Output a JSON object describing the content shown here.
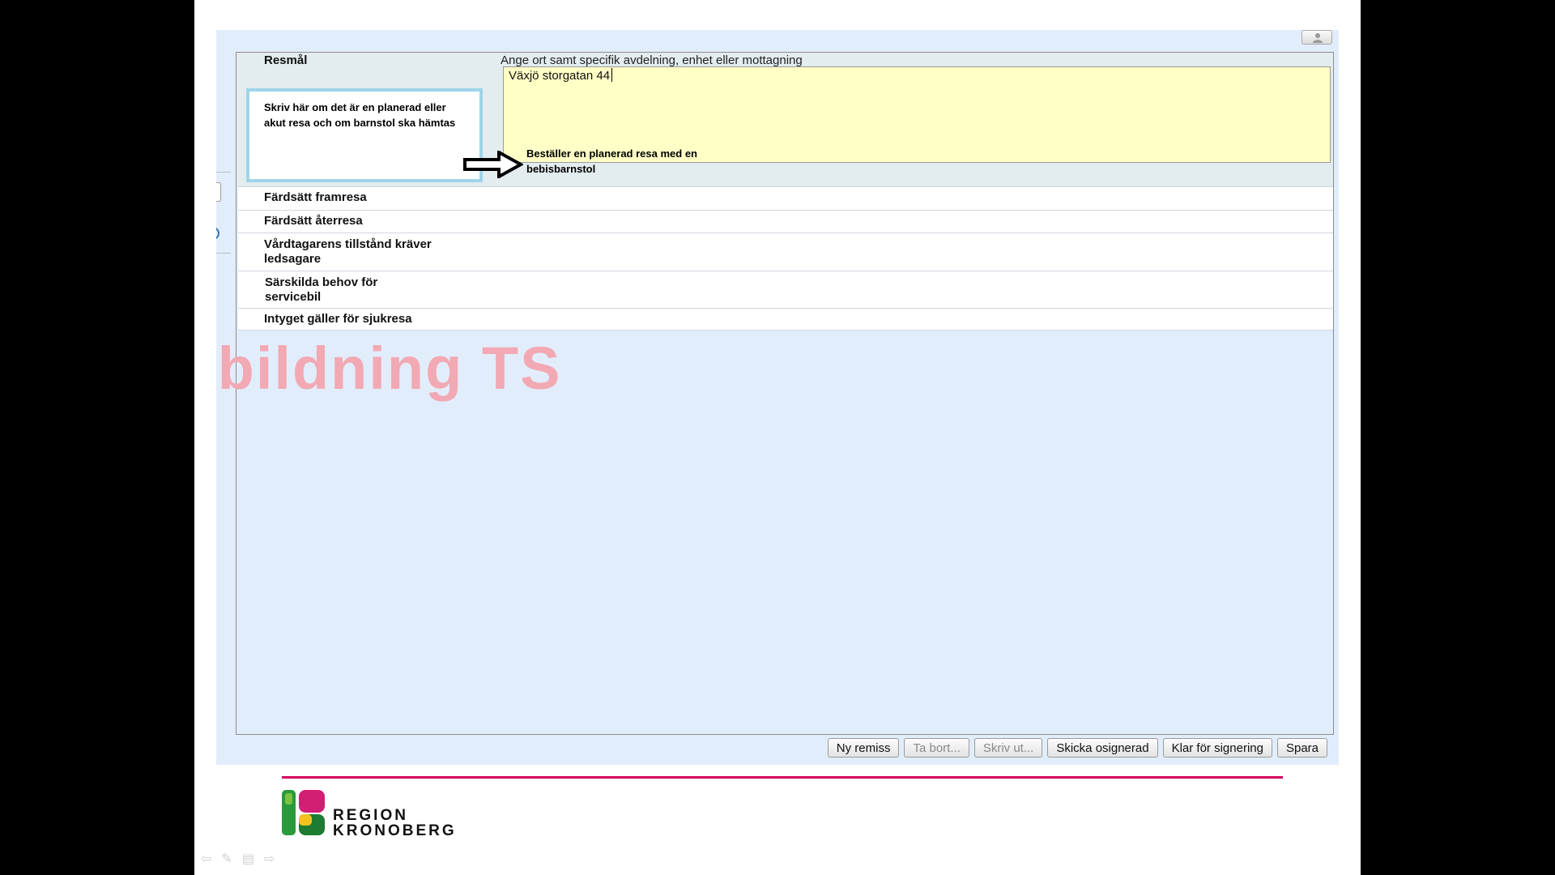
{
  "form": {
    "resmal_label": "Resmål",
    "resmal_hint": "Ange ort samt specifik avdelning, enhet eller mottagning",
    "resmal_value": "Växjö  storgatan 44",
    "rows": [
      {
        "label": "Färdsätt framresa"
      },
      {
        "label": "Färdsätt återresa"
      },
      {
        "label": "Vårdtagarens tillstånd kräver\nledsagare"
      },
      {
        "label": "Särskilda behov för\nservicebil"
      },
      {
        "label": "Intyget gäller för sjukresa"
      }
    ]
  },
  "annotations": {
    "callout": "Skriv här om det är en planerad eller akut resa och om barnstol ska hämtas",
    "note": "Beställer en planerad resa med en bebisbarnstol"
  },
  "watermark": "tbildning TS",
  "buttons": {
    "ny_remiss": "Ny remiss",
    "ta_bort": "Ta bort...",
    "skriv_ut": "Skriv ut...",
    "skicka_osignerad": "Skicka osignerad",
    "klar_for_signering": "Klar för signering",
    "spara": "Spara"
  },
  "logo": {
    "line1": "REGION",
    "line2": "KRONOBERG"
  },
  "colors": {
    "accent_pink": "#d6005f",
    "textarea_bg": "#ffffc6",
    "app_bg": "#e2edfb",
    "callout_border": "#9fd4ea"
  }
}
